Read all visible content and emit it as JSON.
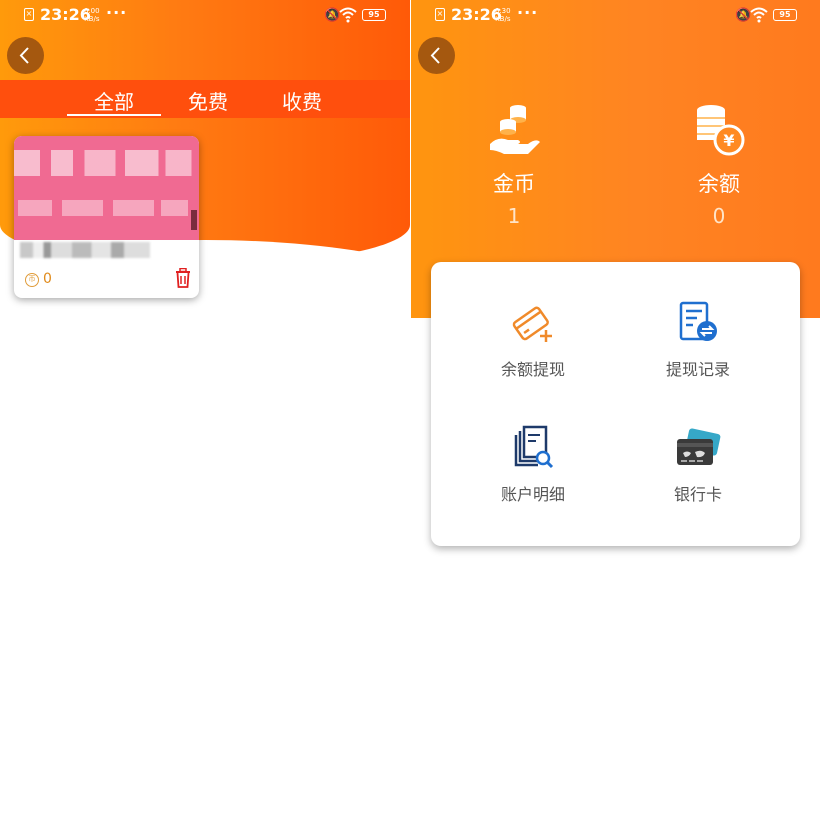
{
  "left": {
    "status_bar": {
      "time": "23:26",
      "speed_value": "0.00",
      "speed_unit": "KB/s",
      "more": "···",
      "battery": "95"
    },
    "back_icon": "chevron-left-icon",
    "tabs": [
      {
        "label": "全部",
        "active": true
      },
      {
        "label": "免费",
        "active": false
      },
      {
        "label": "收费",
        "active": false
      }
    ],
    "card": {
      "coin_count": "0",
      "coin_symbol": "币"
    }
  },
  "right": {
    "status_bar": {
      "time": "23:26",
      "speed_value": "0.30",
      "speed_unit": "KB/s",
      "more": "···",
      "battery": "95"
    },
    "back_icon": "chevron-left-icon",
    "stats": [
      {
        "label": "金币",
        "value": "1",
        "icon": "coins-hand-icon"
      },
      {
        "label": "余额",
        "value": "0",
        "icon": "coins-yen-icon"
      }
    ],
    "actions": [
      {
        "label": "余额提现",
        "icon": "card-plus-icon"
      },
      {
        "label": "提现记录",
        "icon": "record-exchange-icon"
      },
      {
        "label": "账户明细",
        "icon": "document-search-icon"
      },
      {
        "label": "银行卡",
        "icon": "bank-card-icon"
      }
    ],
    "yen_symbol": "¥"
  },
  "colors": {
    "accent_orange": "#ff7a12",
    "tab_bar": "#ff4f0d",
    "back_button": "#a5580f",
    "icon_orange": "#f08a2a",
    "icon_blue": "#1f6fcf",
    "icon_navy": "#1e3a6a"
  }
}
